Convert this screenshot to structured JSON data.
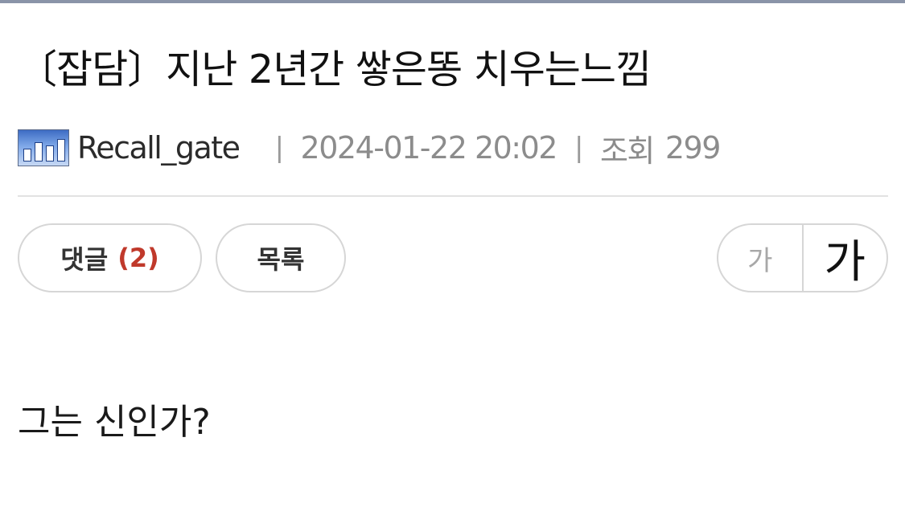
{
  "post": {
    "title": "〔잡담〕지난 2년간 쌓은똥 치우는느낌",
    "author": "Recall_gate",
    "separator": "|",
    "datetime": "2024-01-22 20:02",
    "views_label": "조회",
    "views_count": "299",
    "avatar_icon": "user-avatar-icon",
    "body": "그는 신인가?"
  },
  "actions": {
    "comments_label": "댓글",
    "comments_count": "(2)",
    "list_label": "목록"
  },
  "font_size_control": {
    "small_label": "가",
    "large_label": "가"
  },
  "colors": {
    "comment_count": "#c0392b",
    "top_bar": "#8a94a8",
    "muted_text": "#8c8c8c"
  }
}
